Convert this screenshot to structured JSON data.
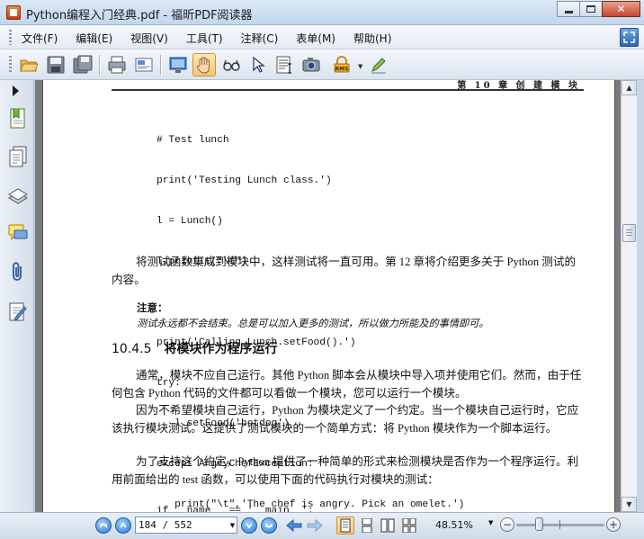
{
  "window": {
    "title": "Python编程入门经典.pdf - 福昕PDF阅读器",
    "controls": {
      "minimize": "",
      "maximize": "",
      "close": "✕"
    }
  },
  "menu": {
    "items": [
      {
        "label": "文件(F)"
      },
      {
        "label": "编辑(E)"
      },
      {
        "label": "视图(V)"
      },
      {
        "label": "工具(T)"
      },
      {
        "label": "注释(C)"
      },
      {
        "label": "表单(M)"
      },
      {
        "label": "帮助(H)"
      }
    ]
  },
  "toolbar": {
    "tools": [
      {
        "name": "open-folder-icon"
      },
      {
        "name": "save-icon"
      },
      {
        "name": "save-as-icon"
      },
      {
        "name": "print-icon"
      },
      {
        "name": "email-icon"
      },
      {
        "name": "screen-icon"
      },
      {
        "name": "hand-tool-icon",
        "active": true
      },
      {
        "name": "magnifier-glasses-icon"
      },
      {
        "name": "select-arrow-icon"
      },
      {
        "name": "text-select-icon"
      },
      {
        "name": "snapshot-camera-icon"
      },
      {
        "name": "rms-lock-icon"
      },
      {
        "name": "sign-pen-icon"
      }
    ],
    "rms_label": "RMS"
  },
  "sidebar": {
    "icons": [
      "bookmarks-icon",
      "pages-icon",
      "layers-icon",
      "comments-icon",
      "attachments-icon",
      "signatures-icon"
    ]
  },
  "document": {
    "running_head": "第 10 章  创 建 模 块",
    "code_block_1": [
      "# Test lunch",
      "print('Testing Lunch class.')",
      "l = Lunch()",
      "l.printIt(\"\\t\")",
      "",
      "print('Calling Lunch.setFood().')",
      "try:",
      "   l.setFood('hotdog')",
      "except AngryChefException:",
      "   print(\"\\t\",'The chef is angry. Pick an omelet.')"
    ],
    "para_1": "将测试函数集成到模块中，这样测试将一直可用。第 12 章将介绍更多关于 Python 测试的内容。",
    "note_title": "注意：",
    "note_body": "测试永远都不会结束。总是可以加入更多的测试，所以做力所能及的事情即可。",
    "section_number": "10.4.5",
    "section_title": "将模块作为程序运行",
    "para_2": "通常，模块不应自己运行。其他 Python 脚本会从模块中导入项并使用它们。然而，由于任何包含 Python 代码的文件都可以看做一个模块，您可以运行一个模块。",
    "para_3": "因为不希望模块自己运行，Python 为模块定义了一个约定。当一个模块自己运行时，它应该执行模块测试。这提供了测试模块的一个简单方式：将 Python 模块作为一个脚本运行。",
    "para_4": "为了支持这个约定，Python 提供了一种简单的形式来检测模块是否作为一个程序运行。利用前面给出的 test 函数，可以使用下面的代码执行对模块的测试：",
    "code_partial": "if __name__ == '__main__':"
  },
  "statusbar": {
    "page_indicator": "184 / 552",
    "zoom": "48.51%",
    "zoom_level_fraction": 0.24
  }
}
